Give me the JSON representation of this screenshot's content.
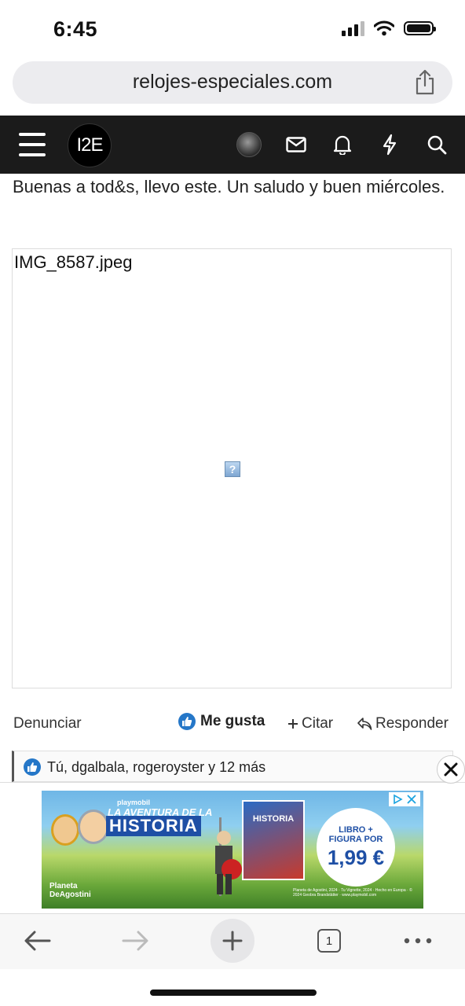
{
  "status_bar": {
    "time": "6:45"
  },
  "browser": {
    "url": "relojes-especiales.com",
    "tab_count": "1"
  },
  "site": {
    "logo_text": "I2E"
  },
  "post": {
    "text": "Buenas a tod&s, llevo este. Un saludo y buen miércoles.",
    "image_name": "IMG_8587.jpeg",
    "broken_image_glyph": "?"
  },
  "actions": {
    "report_label": "Denunciar",
    "like_label": "Me gusta",
    "quote_label": "Citar",
    "reply_label": "Responder"
  },
  "reactions": {
    "text": "Tú, dgalbala, rogeroyster y 12 más"
  },
  "ad": {
    "small_line": "playmobil",
    "title_line1": "LA AVENTURA DE LA",
    "title_line2": "HISTORIA",
    "book_label": "HISTORIA",
    "badge_line1": "LIBRO +",
    "badge_line2": "FIGURA POR",
    "badge_price": "1,99 €",
    "publisher_line1": "Planeta",
    "publisher_line2": "DeAgostini",
    "legal": "Planeta de Agostini, 2024 · Tu Vignette, 2024 · Hecho en Europa · © 2024 Geobra Brandstätter · www.playmobil.com"
  },
  "colors": {
    "header_bg": "#1b1b1b",
    "like_blue": "#2577c8",
    "url_bar_bg": "#ececef"
  }
}
